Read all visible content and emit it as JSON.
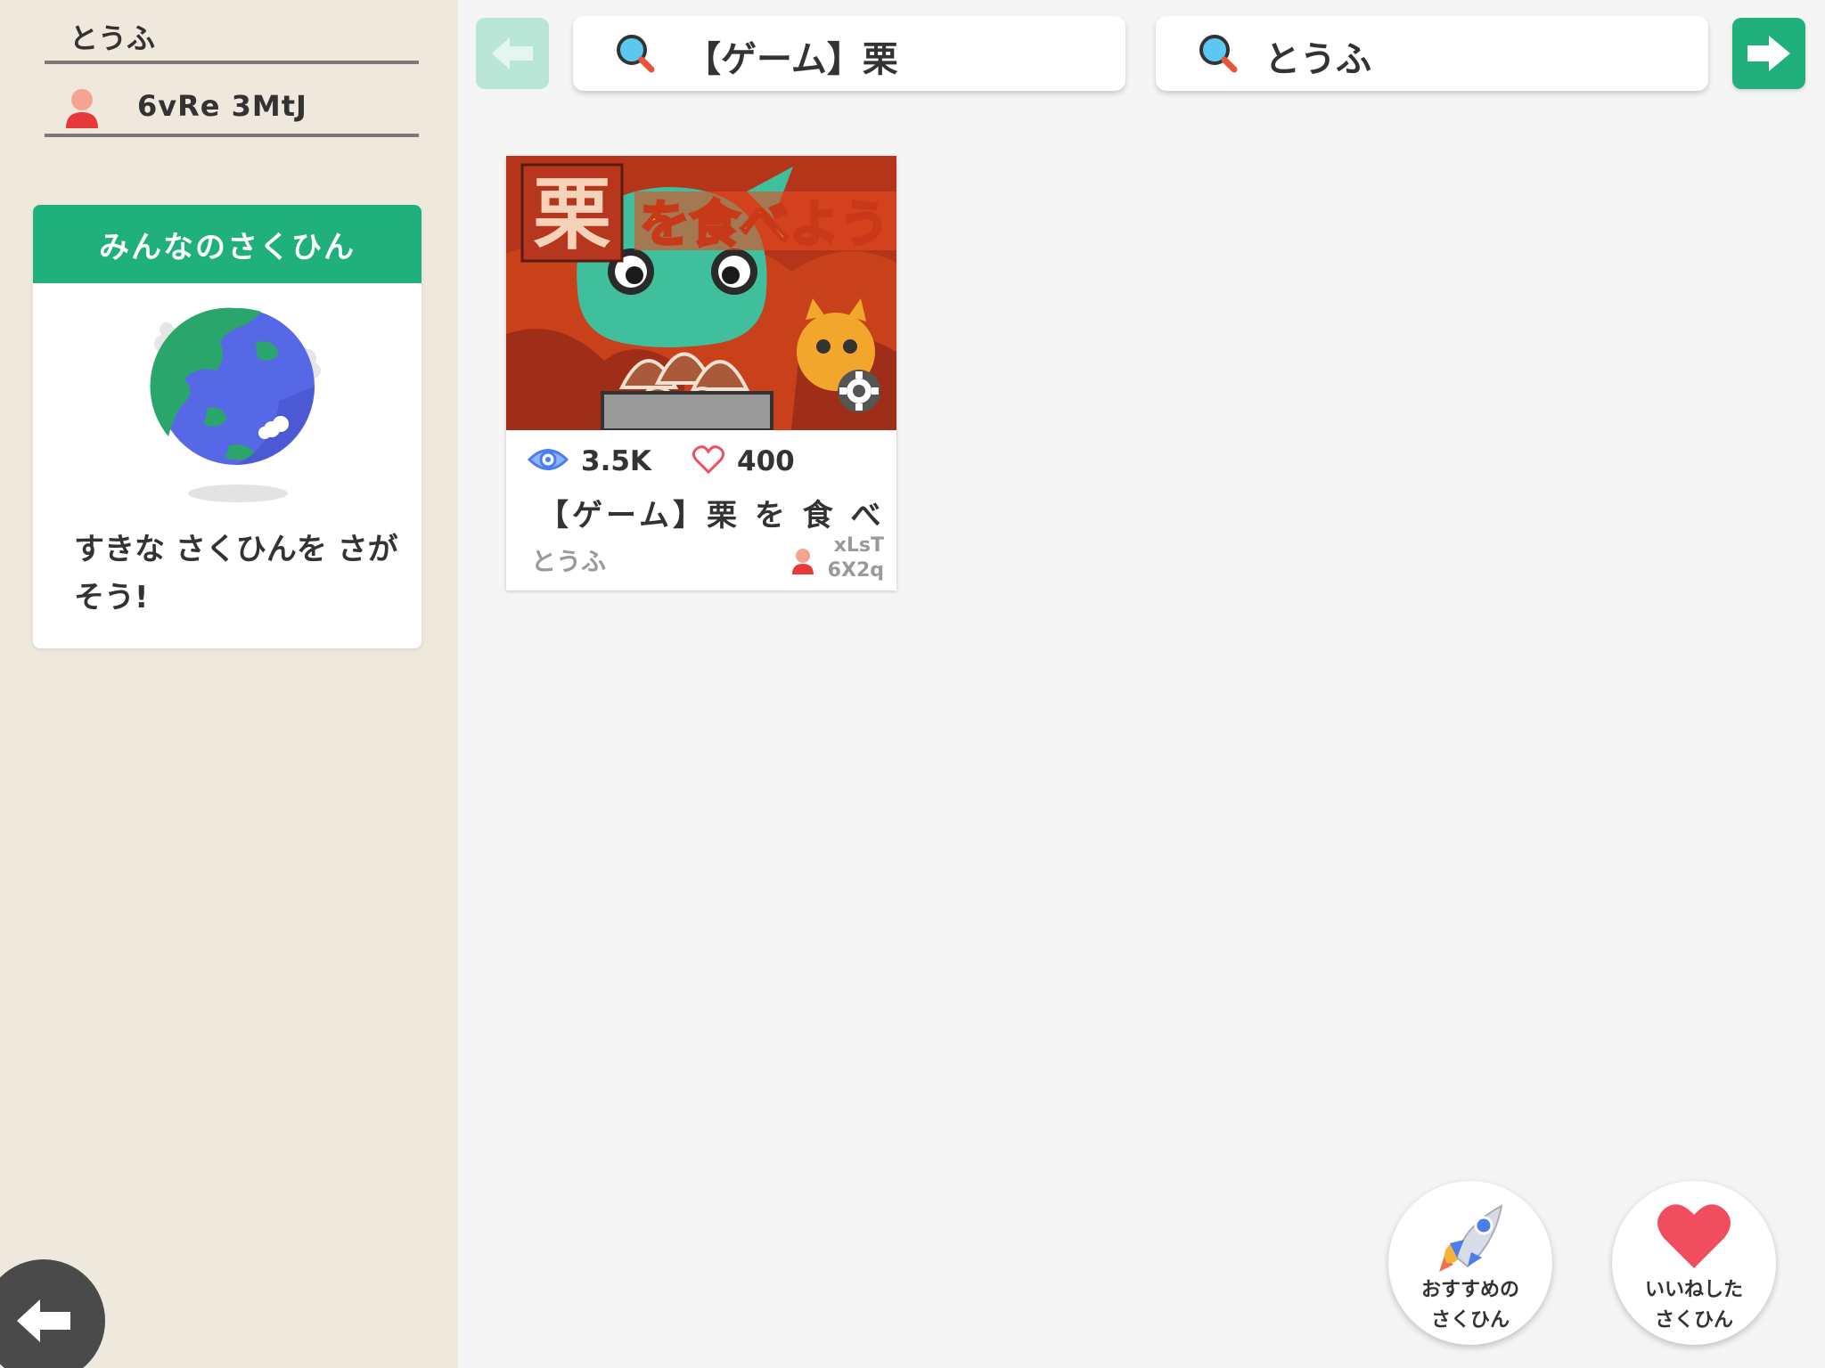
{
  "sidebar": {
    "username": "とうふ",
    "user_id": "6vRe 3MtJ",
    "everyone_card": {
      "header": "みんなのさくひん",
      "description": "すきな さくひんを さがそう!"
    }
  },
  "topbar": {
    "search_title": "【ゲーム】栗",
    "search_author": "とうふ"
  },
  "work": {
    "views": "3.5K",
    "likes": "400",
    "title": "【ゲーム】栗 を 食 べ..",
    "author": "とうふ",
    "user_id_line1": "xLsT",
    "user_id_line2": "6X2q",
    "thumb_text_big": "栗",
    "thumb_text_banner": "を食べよう"
  },
  "floating": {
    "recommended_line1": "おすすめの",
    "recommended_line2": "さくひん",
    "liked_line1": "いいねした",
    "liked_line2": "さくひん"
  },
  "colors": {
    "accent": "#1fb07c",
    "sidebar_bg": "#efe8dd",
    "main_bg": "#f5f5f5",
    "heart": "#f04e5e"
  }
}
